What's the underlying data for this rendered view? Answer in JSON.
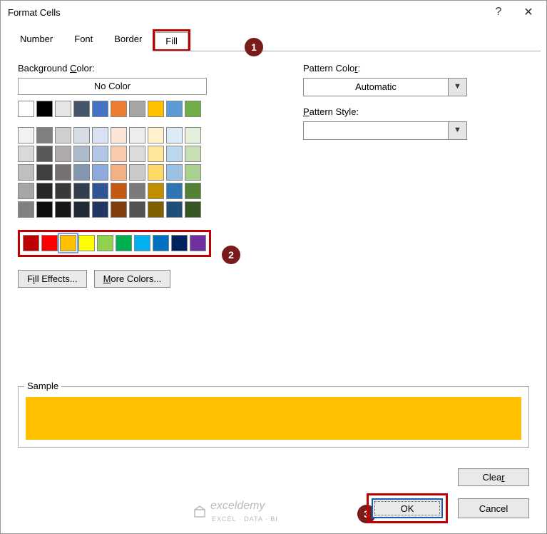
{
  "titlebar": {
    "title": "Format Cells",
    "help": "?",
    "close": "✕"
  },
  "tabs": {
    "number": "Number",
    "font": "Font",
    "border": "Border",
    "fill": "Fill"
  },
  "bg": {
    "label": "Background Color:",
    "nocolor": "No Color",
    "row1": [
      "#ffffff",
      "#000000",
      "#e7e6e6",
      "#44546a",
      "#4472c4",
      "#ed7d31",
      "#a5a5a5",
      "#ffc000",
      "#5b9bd5",
      "#70ad47"
    ],
    "theme": [
      [
        "#f2f2f2",
        "#808080",
        "#d0cece",
        "#d6dce4",
        "#d9e1f2",
        "#fce4d6",
        "#ededed",
        "#fff2cc",
        "#ddebf7",
        "#e2efda"
      ],
      [
        "#d9d9d9",
        "#595959",
        "#aeaaaa",
        "#acb9ca",
        "#b4c6e7",
        "#f8cbad",
        "#dbdbdb",
        "#ffe699",
        "#bdd7ee",
        "#c6e0b4"
      ],
      [
        "#bfbfbf",
        "#404040",
        "#757171",
        "#8497b0",
        "#8ea9db",
        "#f4b084",
        "#c9c9c9",
        "#ffd966",
        "#9bc2e6",
        "#a9d08e"
      ],
      [
        "#a6a6a6",
        "#262626",
        "#3a3838",
        "#333f4f",
        "#305496",
        "#c65911",
        "#7b7b7b",
        "#bf8f00",
        "#2f75b5",
        "#548235"
      ],
      [
        "#808080",
        "#0d0d0d",
        "#161616",
        "#222b35",
        "#203764",
        "#833c0c",
        "#525252",
        "#806000",
        "#1f4e78",
        "#375623"
      ]
    ],
    "std": [
      "#c00000",
      "#ff0000",
      "#ffc000",
      "#ffff00",
      "#92d050",
      "#00b050",
      "#00b0f0",
      "#0070c0",
      "#002060",
      "#7030a0"
    ],
    "fill_effects": "Fill Effects...",
    "more_colors": "More Colors..."
  },
  "pattern": {
    "color_label": "Pattern Color:",
    "color_value": "Automatic",
    "style_label": "Pattern Style:",
    "style_value": ""
  },
  "sample": {
    "label": "Sample",
    "color": "#ffc000"
  },
  "buttons": {
    "clear": "Clear",
    "ok": "OK",
    "cancel": "Cancel"
  },
  "annotations": {
    "n1": "1",
    "n2": "2",
    "n3": "3"
  },
  "watermark": {
    "name": "exceldemy",
    "sub": "EXCEL · DATA · BI"
  },
  "selected_swatch_index": 2
}
